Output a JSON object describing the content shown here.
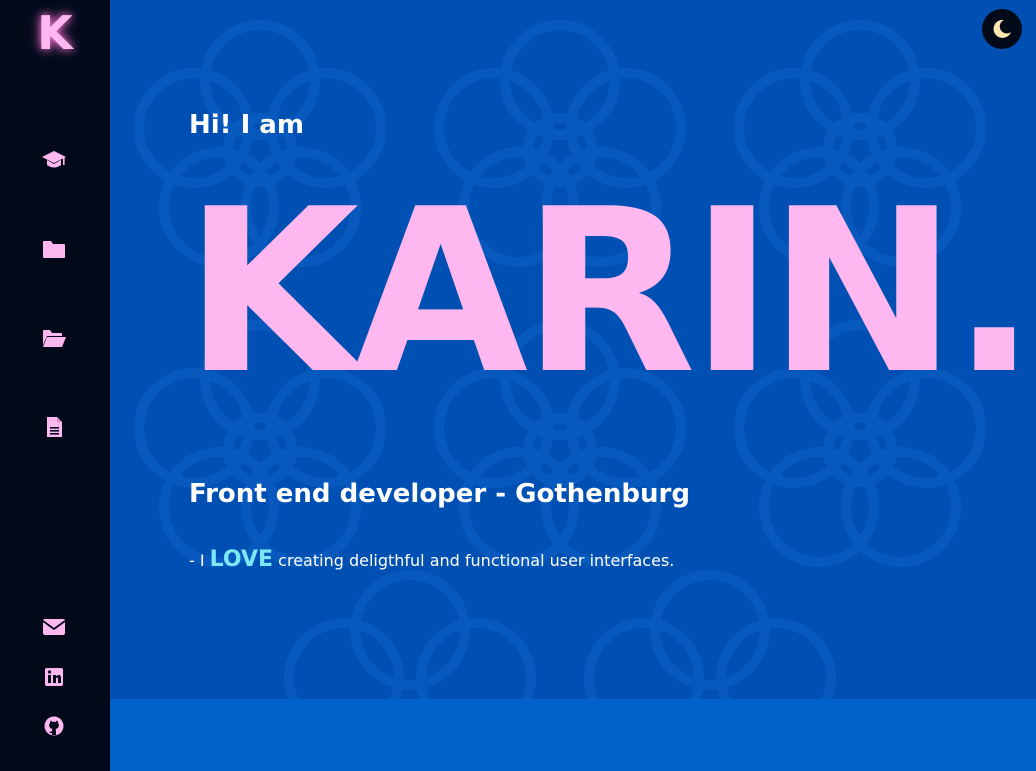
{
  "logo": {
    "letter": "K"
  },
  "sidebar": {
    "nav": [
      {
        "icon": "graduation-cap-icon"
      },
      {
        "icon": "folder-icon"
      },
      {
        "icon": "folder-open-icon"
      },
      {
        "icon": "document-icon"
      }
    ],
    "social": [
      {
        "icon": "envelope-icon"
      },
      {
        "icon": "linkedin-icon"
      },
      {
        "icon": "github-icon"
      }
    ]
  },
  "theme_toggle": {
    "icon": "moon-icon"
  },
  "hero": {
    "greeting": "Hi! I am",
    "name": "KARIN.",
    "role": "Front end developer - Gothenburg",
    "tagline_prefix": "- I",
    "tagline_emphasis": "LOVE",
    "tagline_suffix": "creating deligthful and functional user interfaces."
  },
  "colors": {
    "sidebar_bg": "#020a1a",
    "main_bg": "#0050b4",
    "footer_bg": "#0062c8",
    "accent_pink": "#ffb7f0",
    "accent_cyan": "#7de8f5",
    "text": "#ffffff"
  }
}
